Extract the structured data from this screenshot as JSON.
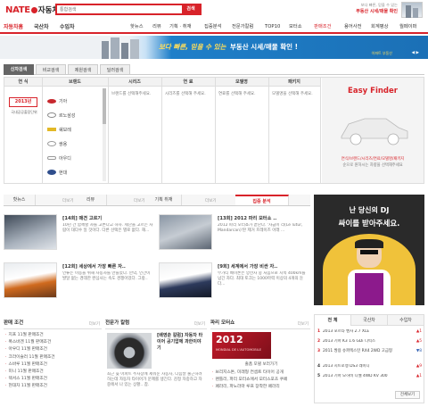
{
  "header": {
    "logo": "NATE",
    "logo_sub": "자동차",
    "search_placeholder": "통합검색",
    "search_button": "검색",
    "promo_line1": "보다 빠른, 믿을 수 있는",
    "promo_line2": "부동산 시세/매물 확인"
  },
  "gnb": {
    "tabs": [
      "자동차홈",
      "국산차",
      "수입차"
    ],
    "items": [
      "핫뉴스",
      "리뷰",
      "기획 · 취재",
      "집중분석",
      "전문가칼럼",
      "TOP10",
      "모터쇼",
      "판매조건",
      "용어사전",
      "회계평상",
      "월페이퍼"
    ]
  },
  "banner": {
    "text_italic": "보다 빠른, 믿을 수 있는",
    "text_main": "부동산 시세/매물 확인 !",
    "sub": "아파트 부동산"
  },
  "search_tabs": [
    "신차검색",
    "비교검색",
    "제원검색",
    "딜러검색"
  ],
  "finder": {
    "columns": [
      "연 식",
      "브랜드",
      "시리즈",
      "연 료",
      "모델명",
      "패키지"
    ],
    "year": "2013년",
    "year_sub": "국내공공출장단위",
    "brands": [
      "기아",
      "르노삼성",
      "쉐보레",
      "쌍용",
      "아우디",
      "현대"
    ],
    "series_hint": "브랜드를 선택해주세요.",
    "fuel_hint": "시리즈를 선택해 주세요.",
    "model_hint": "연료를 선택해 주세요.",
    "package_hint": "모델명을 선택해 주세요.",
    "easy_title": "Easy Finder",
    "easy_desc1": "연식/브랜드/시리즈/연료/모델명/패키지",
    "easy_desc2": "순으로 원하시는 차량을 선택해주세요"
  },
  "news_tabs": [
    "핫뉴스",
    "리뷰",
    "기획 취재",
    "집중 분석"
  ],
  "news_more": "더보기",
  "news": [
    {
      "title": "[14회] 매견 고르기",
      "desc": "10년 간 함께할 차를 고른다고 하자. 세단을 고르는 사람이 대다수 일 것이다. 다른 선택은 별로 없다. 해..."
    },
    {
      "title": "[13회] 2012 파리 모터쇼 ..",
      "desc": "2012 파리 모터쇼가 끝난다. '자금이 리(Le lutur, Mandarcan)'란 제거 프레이즈 아래 ..."
    },
    {
      "title": "[12회] 세상에서 가장 빠른 자..",
      "desc": "인류는 이동을 위해 자동차를 만들었다. 만약, 인간이 발달 없는 경데한 완심사는 속도 경쟁이었다. 그랑.."
    },
    {
      "title": "[9회] 세계에서 가장 비싼 자..",
      "desc": "부가티 베이론은 양산차 중 처음으로 시속 400km를 넘긴 차다. 최대 토크는 1000마력 이상의 4개의 둔다..."
    }
  ],
  "ad": {
    "line1": "난 당신의 DJ",
    "line2": "싸이를 받아주세요."
  },
  "sale": {
    "title": "판매 조건",
    "items": [
      "지프 11월 판매조건",
      "폭스바겐 11월 판매조건",
      "아우디 11월 판매조건",
      "크라이슬러 11월 판매조건",
      "스바루 11월 판매조건",
      "미니 11월 판매조건",
      "렉서스 11월 판매조건",
      "현대차 11월 판매조건"
    ]
  },
  "column": {
    "title": "전문가 칼럼",
    "headline": "[배영춘 칼럼] 자동차 타이어 공기압에 과한이야기",
    "desc": "최근 늦 아파트 주차장에 세워둔 자동차, 다음날 출근하려 하는데 자동차 타이어가 문제를 생긴다. 감정 자중하고 자중에서 나 있는 상황.. 참."
  },
  "motorshow": {
    "title": "파리 모터쇼",
    "poster_text": "MONDIAL DE L'AUTOMOBILE",
    "caption": "출품 모델 보러가기",
    "items": [
      "브리지스톤, 미래형 컨셉트 타이어 공개",
      "렌틀리, 파리 모터쇼에서 모터스포츠 쿠페",
      "페라리, 파노라마 루프 장착한 페라리"
    ]
  },
  "rank": {
    "tabs": [
      "전 체",
      "국산차",
      "수입차"
    ],
    "items": [
      {
        "rank": "1",
        "name": "2013 포르타 벤자 2.7 XLE",
        "change": "▲1"
      },
      {
        "rank": "2",
        "name": "2013 기아 K3 1.6 GDi 디럭스",
        "change": "▲5"
      },
      {
        "rank": "3",
        "name": "2011 쌍용 슈퍼렉스턴 RX4 2WD 고급형",
        "change": "▼8"
      },
      {
        "rank": "4",
        "name": "2013 시트로엥 DS3 레이디",
        "change": "▲9"
      },
      {
        "rank": "5",
        "name": "2013 기아 모하비 디젤 4WD KV 300",
        "change": "▲1"
      }
    ],
    "all_button": "전체보기"
  },
  "colors": {
    "accent": "#d8232a",
    "line": "#dddddd"
  }
}
